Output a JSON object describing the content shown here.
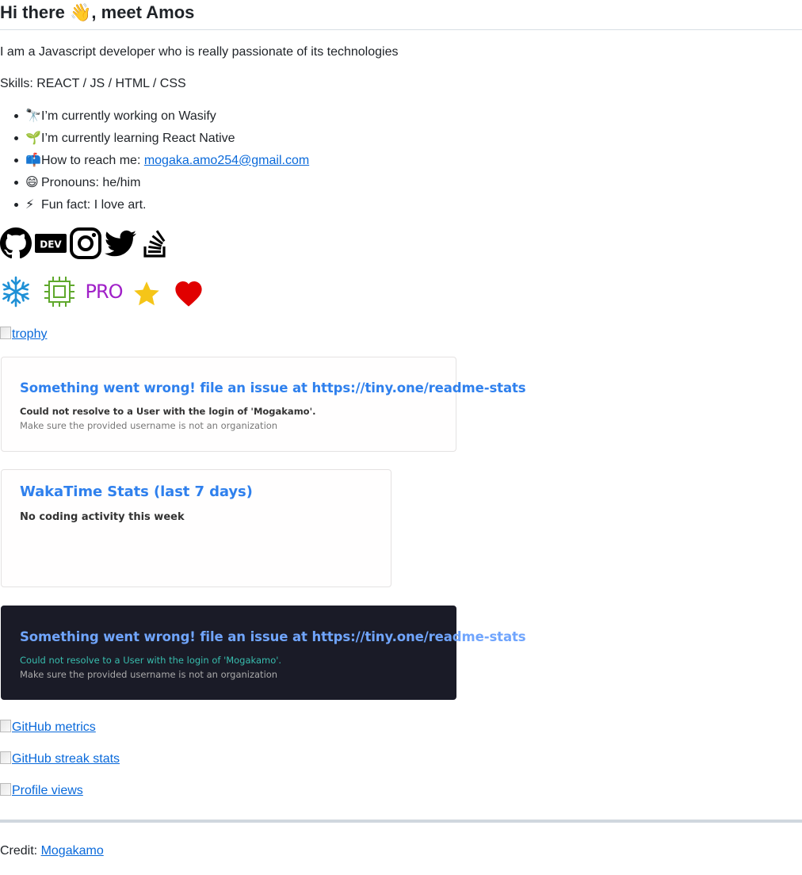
{
  "header": {
    "title": "Hi there 👋, meet Amos"
  },
  "intro": "I am a Javascript developer who is really passionate of its technologies",
  "skills": "Skills: REACT / JS / HTML / CSS",
  "facts": [
    {
      "emoji": "🔭",
      "text": "I’m currently working on Wasify"
    },
    {
      "emoji": "🌱",
      "text": "I’m currently learning React Native"
    },
    {
      "emoji": "📫",
      "text": "How to reach me: ",
      "link": "mogaka.amo254@gmail.com"
    },
    {
      "emoji": "😄",
      "text": "Pronouns: he/him"
    },
    {
      "emoji": "⚡",
      "text": "Fun fact: I love art."
    }
  ],
  "socials": [
    {
      "icon": "github-icon"
    },
    {
      "icon": "dev-icon",
      "label": "DEV"
    },
    {
      "icon": "instagram-icon"
    },
    {
      "icon": "twitter-icon"
    },
    {
      "icon": "stackoverflow-icon"
    }
  ],
  "badges": [
    {
      "icon": "snowflake-icon",
      "color": "#1e90d6"
    },
    {
      "icon": "chip-icon",
      "color": "#5fa82c"
    },
    {
      "icon": "pro-badge-icon",
      "label": "PRO",
      "color": "#a020c8"
    },
    {
      "icon": "star-icon",
      "color": "#f5c518"
    },
    {
      "icon": "heart-icon",
      "color": "#e00000"
    }
  ],
  "trophy_alt": "trophy",
  "stats_card": {
    "title": "Something went wrong! file an issue at https://tiny.one/readme-stats",
    "message": "Could not resolve to a User with the login of 'Mogakamo'.",
    "sub": "Make sure the provided username is not an organization"
  },
  "wakatime_card": {
    "title": "WakaTime Stats (last 7 days)",
    "message": "No coding activity this week"
  },
  "langs_card": {
    "title": "Something went wrong! file an issue at https://tiny.one/readme-stats",
    "message": "Could not resolve to a User with the login of 'Mogakamo'.",
    "sub": "Make sure the provided username is not an organization"
  },
  "images": {
    "metrics_alt": "GitHub metrics",
    "streak_alt": "GitHub streak stats",
    "views_alt": "Profile views"
  },
  "credit": {
    "label": "Credit: ",
    "link": "Mogakamo"
  }
}
